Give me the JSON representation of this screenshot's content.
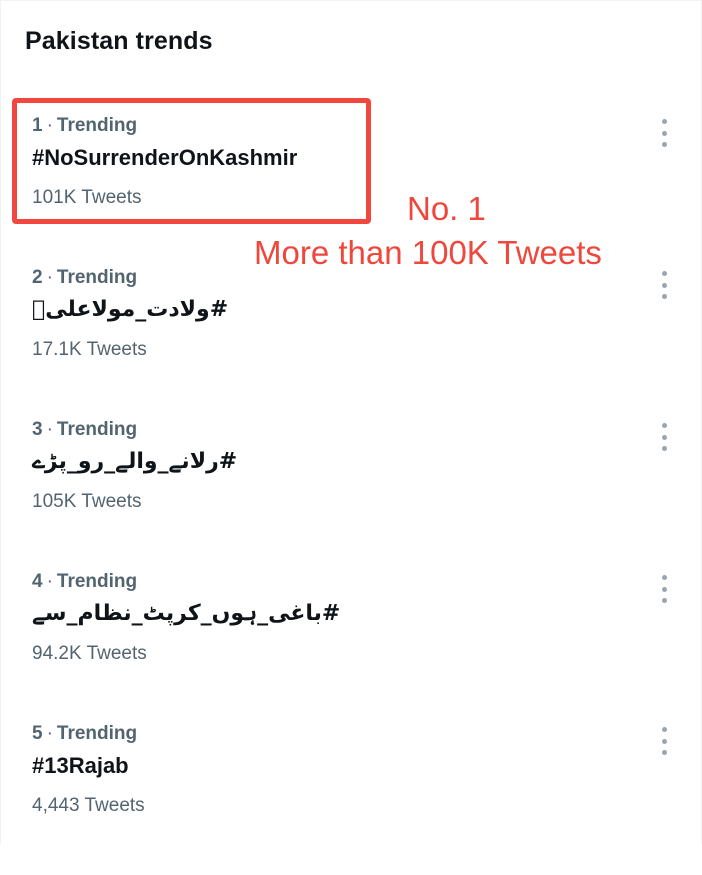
{
  "header": {
    "title": "Pakistan trends"
  },
  "trends": [
    {
      "rank": "1",
      "label": "Trending",
      "tag": "#NoSurrenderOnKashmir",
      "tweets": "101K Tweets"
    },
    {
      "rank": "2",
      "label": "Trending",
      "tag": "#ولادت_مولاعلیؑ",
      "tweets": "17.1K Tweets"
    },
    {
      "rank": "3",
      "label": "Trending",
      "tag": "#رلانے_والے_رو_پڑے",
      "tweets": "105K Tweets"
    },
    {
      "rank": "4",
      "label": "Trending",
      "tag": "#باغی_ہوں_کرپٹ_نظام_سے",
      "tweets": "94.2K Tweets"
    },
    {
      "rank": "5",
      "label": "Trending",
      "tag": "#13Rajab",
      "tweets": "4,443 Tweets"
    }
  ],
  "annotation": {
    "line1": "No. 1",
    "line2": "More than 100K Tweets",
    "color": "#f0473c"
  },
  "icons": {
    "more": "more-vertical-icon"
  }
}
